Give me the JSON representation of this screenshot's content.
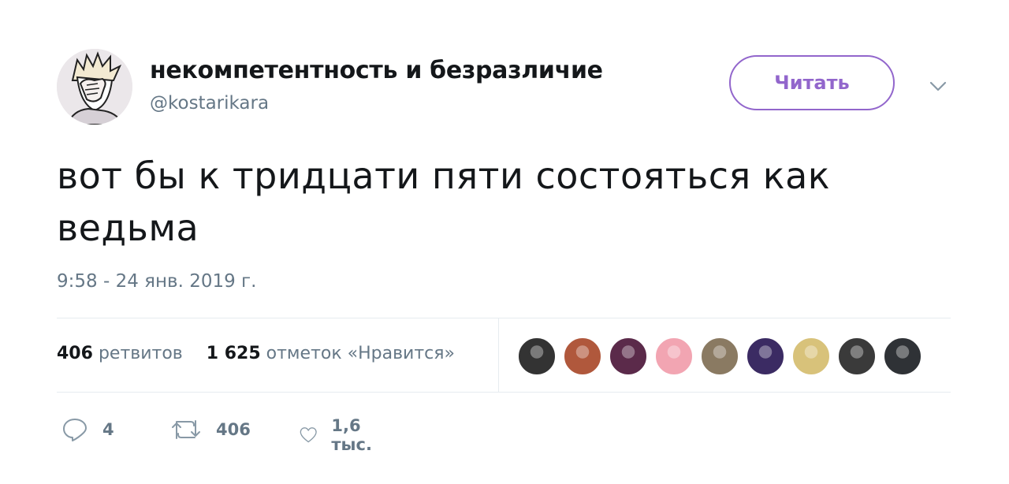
{
  "author": {
    "display_name": "некомпетентность и безразличие",
    "handle": "@kostarikara",
    "avatar_icon": "facepalm-avatar"
  },
  "follow_button": {
    "label": "Читать",
    "color": "#9266cc"
  },
  "menu_icon": "chevron-down-icon",
  "tweet": {
    "text": "вот бы к тридцати пяти состояться как ведьма",
    "timestamp": "9:58 - 24 янв. 2019 г."
  },
  "stats": {
    "retweets_count": "406",
    "retweets_label": "ретвитов",
    "likes_count": "1 625",
    "likes_label": "отметок «Нравится»"
  },
  "liker_avatars": [
    {
      "name": "liker-avatar-1",
      "color": "#333333"
    },
    {
      "name": "liker-avatar-2",
      "color": "#b0583c"
    },
    {
      "name": "liker-avatar-3",
      "color": "#5b2a4a"
    },
    {
      "name": "liker-avatar-4",
      "color": "#f2a5b2"
    },
    {
      "name": "liker-avatar-5",
      "color": "#8a7a62"
    },
    {
      "name": "liker-avatar-6",
      "color": "#3b2b63"
    },
    {
      "name": "liker-avatar-7",
      "color": "#d8c27a"
    },
    {
      "name": "liker-avatar-8",
      "color": "#3a3a3a"
    },
    {
      "name": "liker-avatar-9",
      "color": "#2f3236"
    }
  ],
  "actions": {
    "reply": {
      "icon": "reply-icon",
      "count": "4"
    },
    "retweet": {
      "icon": "retweet-icon",
      "count": "406"
    },
    "like": {
      "icon": "heart-icon",
      "count": "1,6 тыс."
    }
  }
}
